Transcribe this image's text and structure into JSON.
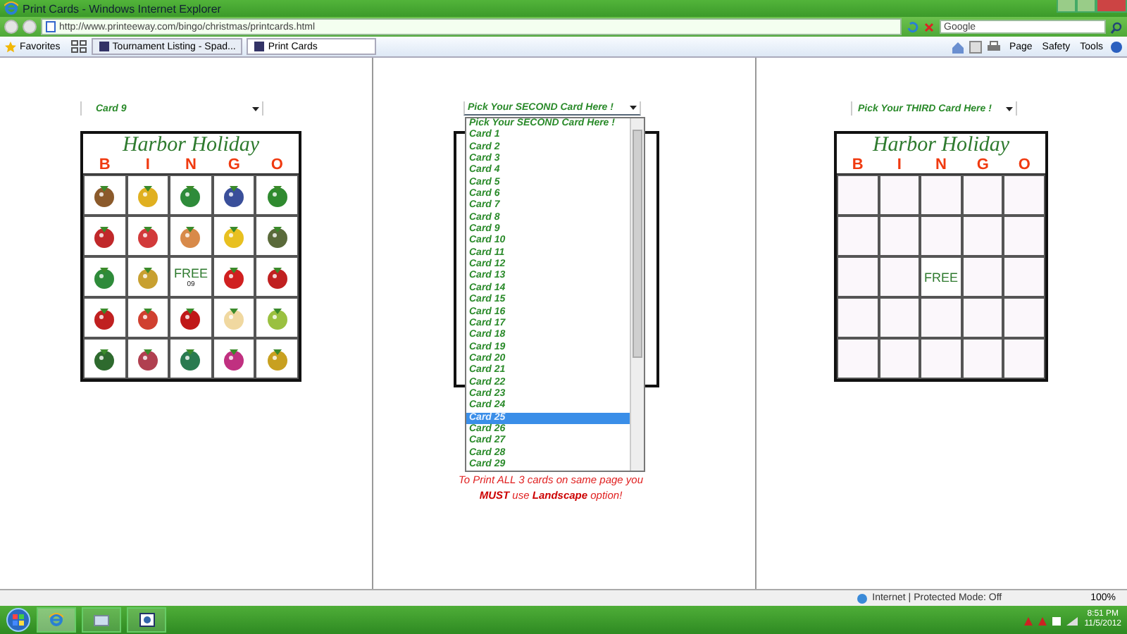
{
  "window": {
    "title": "Print Cards - Windows Internet Explorer"
  },
  "address_bar": {
    "url": "http://www.printeeway.com/bingo/christmas/printcards.html"
  },
  "search": {
    "placeholder": "Google"
  },
  "favorites": {
    "label": "Favorites"
  },
  "tabs": [
    {
      "label": "Tournament Listing - Spad...",
      "selected": false
    },
    {
      "label": "Print Cards",
      "selected": true
    }
  ],
  "command_bar": [
    "Page",
    "Safety",
    "Tools"
  ],
  "columns": [
    {
      "select": {
        "value": "Card 9"
      },
      "card": {
        "title": "Harbor Holiday",
        "letters": [
          "B",
          "I",
          "N",
          "G",
          "O"
        ],
        "cells": [
          {
            "kind": "picture"
          },
          {
            "kind": "picture"
          },
          {
            "kind": "picture"
          },
          {
            "kind": "picture"
          },
          {
            "kind": "picture"
          },
          {
            "kind": "picture"
          },
          {
            "kind": "picture"
          },
          {
            "kind": "picture"
          },
          {
            "kind": "picture"
          },
          {
            "kind": "picture"
          },
          {
            "kind": "picture"
          },
          {
            "kind": "picture"
          },
          {
            "kind": "free",
            "label": "FREE",
            "sub": "09"
          },
          {
            "kind": "picture"
          },
          {
            "kind": "picture"
          },
          {
            "kind": "picture"
          },
          {
            "kind": "picture"
          },
          {
            "kind": "picture"
          },
          {
            "kind": "picture"
          },
          {
            "kind": "picture"
          },
          {
            "kind": "picture"
          },
          {
            "kind": "picture"
          },
          {
            "kind": "picture"
          },
          {
            "kind": "picture"
          },
          {
            "kind": "picture"
          }
        ]
      }
    },
    {
      "select": {
        "value": "Pick Your SECOND Card Here !"
      },
      "card_frame": true,
      "dropdown": {
        "options": [
          {
            "label": "Pick Your SECOND Card Here !",
            "selected": false
          },
          {
            "label": "Card 1",
            "selected": false
          },
          {
            "label": "Card 2",
            "selected": false
          },
          {
            "label": "Card 3",
            "selected": false
          },
          {
            "label": "Card 4",
            "selected": false
          },
          {
            "label": "Card 5",
            "selected": false
          },
          {
            "label": "Card 6",
            "selected": false
          },
          {
            "label": "Card 7",
            "selected": false
          },
          {
            "label": "Card 8",
            "selected": false
          },
          {
            "label": "Card 9",
            "selected": false
          },
          {
            "label": "Card 10",
            "selected": false
          },
          {
            "label": "Card 11",
            "selected": false
          },
          {
            "label": "Card 12",
            "selected": false
          },
          {
            "label": "Card 13",
            "selected": false
          },
          {
            "label": "Card 14",
            "selected": false
          },
          {
            "label": "Card 15",
            "selected": false
          },
          {
            "label": "Card 16",
            "selected": false
          },
          {
            "label": "Card 17",
            "selected": false
          },
          {
            "label": "Card 18",
            "selected": false
          },
          {
            "label": "Card 19",
            "selected": false
          },
          {
            "label": "Card 20",
            "selected": false
          },
          {
            "label": "Card 21",
            "selected": false
          },
          {
            "label": "Card 22",
            "selected": false
          },
          {
            "label": "Card 23",
            "selected": false
          },
          {
            "label": "Card 24",
            "selected": false
          },
          {
            "label": "Card 25",
            "selected": true
          },
          {
            "label": "Card 26",
            "selected": false
          },
          {
            "label": "Card 27",
            "selected": false
          },
          {
            "label": "Card 28",
            "selected": false
          },
          {
            "label": "Card 29",
            "selected": false
          }
        ]
      },
      "note": "To Print ALL 3 cards on same page you **MUST** use **Landscape** option!"
    },
    {
      "select": {
        "value": "Pick Your THIRD Card Here !"
      },
      "card": {
        "title": "Harbor Holiday",
        "letters": [
          "B",
          "I",
          "N",
          "G",
          "O"
        ],
        "cells": [
          {
            "kind": "empty"
          },
          {
            "kind": "empty"
          },
          {
            "kind": "empty"
          },
          {
            "kind": "empty"
          },
          {
            "kind": "empty"
          },
          {
            "kind": "empty"
          },
          {
            "kind": "empty"
          },
          {
            "kind": "empty"
          },
          {
            "kind": "empty"
          },
          {
            "kind": "empty"
          },
          {
            "kind": "empty"
          },
          {
            "kind": "empty"
          },
          {
            "kind": "free",
            "label": "FREE"
          },
          {
            "kind": "empty"
          },
          {
            "kind": "empty"
          },
          {
            "kind": "empty"
          },
          {
            "kind": "empty"
          },
          {
            "kind": "empty"
          },
          {
            "kind": "empty"
          },
          {
            "kind": "empty"
          },
          {
            "kind": "empty"
          },
          {
            "kind": "empty"
          },
          {
            "kind": "empty"
          },
          {
            "kind": "empty"
          },
          {
            "kind": "empty"
          }
        ]
      }
    }
  ],
  "status_bar": {
    "zone": "Internet | Protected Mode: Off",
    "zoom": "100%"
  },
  "taskbar": {
    "time": "8:51 PM",
    "date": "11/5/2012"
  }
}
